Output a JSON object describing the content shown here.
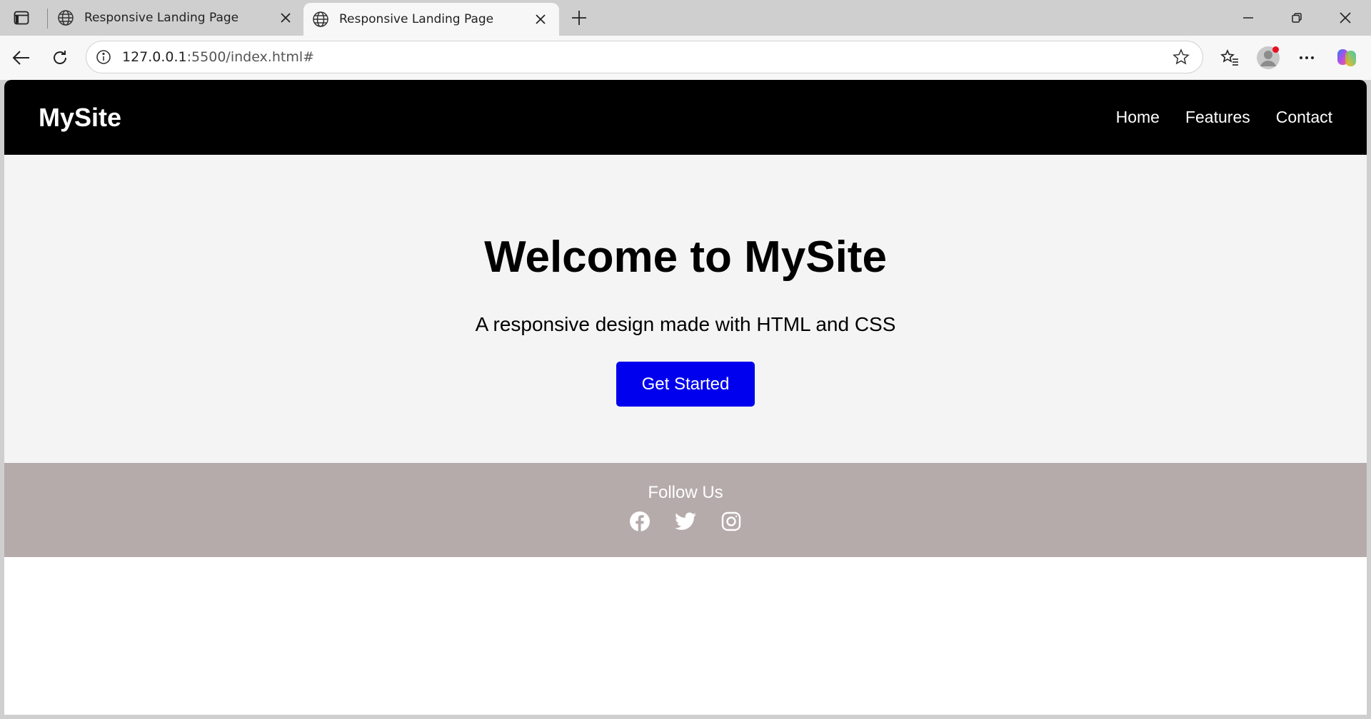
{
  "browser": {
    "tabs": [
      {
        "title": "Responsive Landing Page",
        "active": false
      },
      {
        "title": "Responsive Landing Page",
        "active": true
      }
    ],
    "url_host": "127.0.0.1",
    "url_rest": ":5500/index.html#"
  },
  "site": {
    "logo": "MySite",
    "nav": [
      "Home",
      "Features",
      "Contact"
    ],
    "hero": {
      "title": "Welcome to MySite",
      "subtitle": "A responsive design made with HTML and CSS",
      "cta": "Get Started"
    },
    "footer": {
      "follow": "Follow Us",
      "socials": [
        "facebook-icon",
        "twitter-icon",
        "instagram-icon"
      ]
    }
  },
  "colors": {
    "nav_bg": "#000000",
    "hero_bg": "#f4f4f4",
    "cta_bg": "#0000ee",
    "footer_bg": "#b5abaa"
  }
}
